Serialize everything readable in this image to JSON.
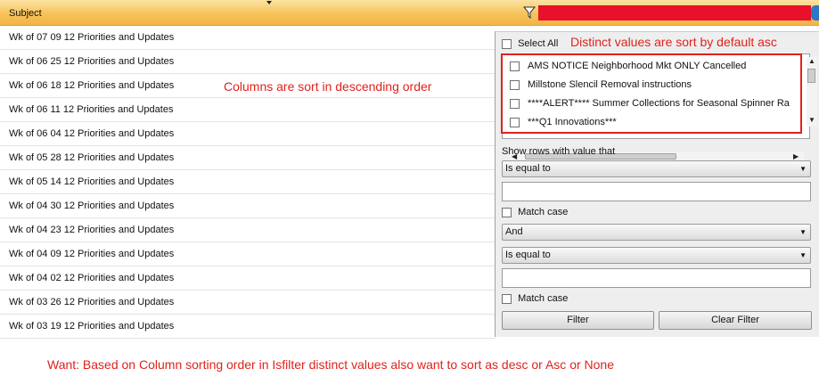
{
  "grid": {
    "column_header": "Subject",
    "rows": [
      "Wk of 07 09 12 Priorities and Updates",
      "Wk of 06 25 12 Priorities and Updates",
      "Wk of 06 18 12 Priorities and Updates",
      "Wk of 06 11 12 Priorities and Updates",
      "Wk of 06 04 12 Priorities and Updates",
      "Wk of 05 28 12 Priorities and Updates",
      "Wk of 05 14 12 Priorities and Updates",
      "Wk of 04 30 12 Priorities and Updates",
      "Wk of 04 23 12 Priorities and Updates",
      "Wk of 04 09 12 Priorities and Updates",
      "Wk of 04 02 12 Priorities and Updates",
      "Wk of 03 26 12 Priorities and Updates",
      "Wk of 03 19 12 Priorities and Updates"
    ]
  },
  "annotations": {
    "columns_sort": "Columns are sort in descending order",
    "distinct_sort": "Distinct values are sort by default asc",
    "want": "Want: Based on Column sorting order in Isfilter distinct values also want to sort as desc or Asc or None"
  },
  "filter": {
    "select_all": "Select All",
    "distinct_values": [
      "AMS NOTICE Neighborhood Mkt ONLY Cancelled",
      "Millstone Slencil Removal instructions",
      "****ALERT**** Summer Collections for Seasonal Spinner Ra",
      "***Q1 Innovations***"
    ],
    "show_rows_label": "Show rows with value that",
    "operator1": "Is equal to",
    "match_case_1": "Match case",
    "logical_operator": "And",
    "operator2": "Is equal to",
    "match_case_2": "Match case",
    "filter_button": "Filter",
    "clear_button": "Clear Filter"
  },
  "colors": {
    "header_orange": "#f7c35a",
    "highlight_red": "#e8102a",
    "annotation_red": "#e0221c",
    "tab_blue": "#2f77c6"
  },
  "icons": [
    "sort-indicator-icon",
    "filter-funnel-icon",
    "scroll-up-icon",
    "scroll-down-icon",
    "scroll-left-icon",
    "scroll-right-icon",
    "dropdown-arrow-icon"
  ]
}
